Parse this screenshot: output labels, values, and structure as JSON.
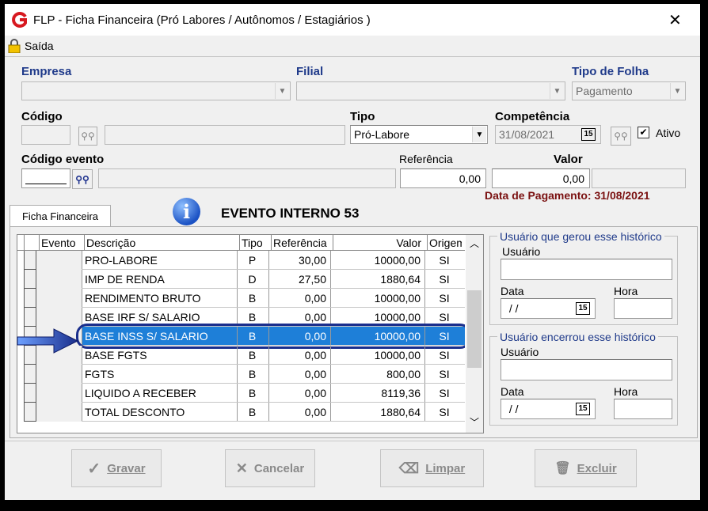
{
  "window": {
    "title": "FLP - Ficha Financeira (Pró Labores / Autônomos / Estagiários )",
    "logo": "G",
    "close_glyph": "✕"
  },
  "menu": {
    "exit_label": "Saída"
  },
  "form": {
    "empresa_label": "Empresa",
    "filial_label": "Filial",
    "tipo_folha_label": "Tipo de Folha",
    "tipo_folha_value": "Pagamento",
    "codigo_label": "Código",
    "tipo_label": "Tipo",
    "tipo_value": "Pró-Labore",
    "competencia_label": "Competência",
    "competencia_value": "31/08/2021",
    "ativo_label": "Ativo",
    "codigo_evento_label": "Código evento",
    "referencia_label": "Referência",
    "referencia_value": "0,00",
    "valor_label": "Valor",
    "valor_value": "0,00",
    "data_pagamento": "Data de Pagamento: 31/08/2021"
  },
  "tab": {
    "label": "Ficha Financeira"
  },
  "banner": {
    "text": "EVENTO INTERNO 53",
    "icon": "info-icon"
  },
  "table": {
    "headers": [
      "Evento",
      "Descrição",
      "Tipo",
      "Referência",
      "Valor",
      "Origem"
    ],
    "rows": [
      {
        "descricao": "PRO-LABORE",
        "tipo": "P",
        "referencia": "30,00",
        "valor": "10000,00",
        "origem": "SI"
      },
      {
        "descricao": "IMP DE RENDA",
        "tipo": "D",
        "referencia": "27,50",
        "valor": "1880,64",
        "origem": "SI"
      },
      {
        "descricao": "RENDIMENTO BRUTO",
        "tipo": "B",
        "referencia": "0,00",
        "valor": "10000,00",
        "origem": "SI"
      },
      {
        "descricao": "BASE IRF S/ SALARIO",
        "tipo": "B",
        "referencia": "0,00",
        "valor": "10000,00",
        "origem": "SI"
      },
      {
        "descricao": "BASE INSS S/ SALARIO",
        "tipo": "B",
        "referencia": "0,00",
        "valor": "10000,00",
        "origem": "SI"
      },
      {
        "descricao": "BASE FGTS",
        "tipo": "B",
        "referencia": "0,00",
        "valor": "10000,00",
        "origem": "SI"
      },
      {
        "descricao": "FGTS",
        "tipo": "B",
        "referencia": "0,00",
        "valor": "800,00",
        "origem": "SI"
      },
      {
        "descricao": "LIQUIDO A RECEBER",
        "tipo": "B",
        "referencia": "0,00",
        "valor": "8119,36",
        "origem": "SI"
      },
      {
        "descricao": "TOTAL DESCONTO",
        "tipo": "B",
        "referencia": "0,00",
        "valor": "1880,64",
        "origem": "SI"
      }
    ],
    "selected_row": 4
  },
  "created_group": {
    "title": "Usuário que gerou esse histórico",
    "usuario_label": "Usuário",
    "data_label": "Data",
    "data_value": " / /",
    "hora_label": "Hora"
  },
  "closed_group": {
    "title": "Usuário encerrou esse histórico",
    "usuario_label": "Usuário",
    "data_label": "Data",
    "data_value": " / /",
    "hora_label": "Hora"
  },
  "buttons": {
    "gravar": "Gravar",
    "cancelar": "Cancelar",
    "limpar": "Limpar",
    "excluir": "Excluir"
  },
  "colors": {
    "label_blue": "#1f3a8a",
    "highlight": "#1e7fd8",
    "annotation_navy": "#1a2e8c",
    "payment_date": "#7a1010"
  }
}
